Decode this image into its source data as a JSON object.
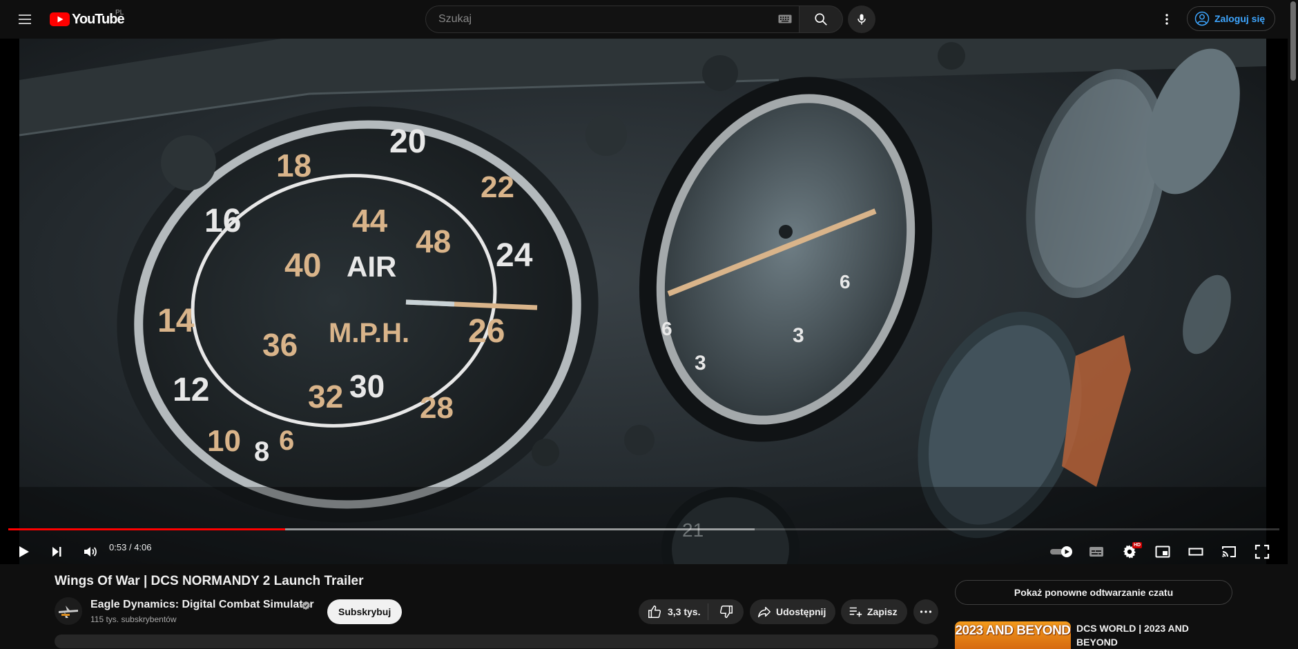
{
  "header": {
    "logo_text": "YouTube",
    "region": "PL",
    "search_placeholder": "Szukaj",
    "signin_label": "Zaloguj się"
  },
  "player": {
    "time_current": "0:53",
    "time_separator": "/",
    "time_total": "4:06",
    "progress_played": 0.218,
    "progress_buffered": 0.587,
    "hd_badge": "HD",
    "gauge_airspeed": {
      "outer_numbers": [
        "6",
        "8",
        "10",
        "12",
        "14",
        "16",
        "18",
        "20",
        "22",
        "24",
        "26",
        "28"
      ],
      "inner_numbers": [
        "30",
        "32",
        "36",
        "40",
        "44",
        "48"
      ],
      "word_top": "AIR",
      "word_bottom": "M.P.H."
    },
    "gauge_right_numbers": [
      "3",
      "6",
      "3",
      "6",
      "21"
    ]
  },
  "video": {
    "title": "Wings Of War | DCS NORMANDY 2 Launch Trailer",
    "channel_name": "Eagle Dynamics: Digital Combat Simulator",
    "subscribers": "115 tys. subskrybentów",
    "subscribe_label": "Subskrybuj",
    "likes": "3,3 tys.",
    "share_label": "Udostępnij",
    "save_label": "Zapisz"
  },
  "sidebar": {
    "chat_replay_label": "Pokaż ponowne odtwarzanie czatu",
    "recommended": [
      {
        "thumb_text": "2023 AND BEYOND",
        "title": "DCS WORLD | 2023 AND BEYOND"
      }
    ]
  },
  "colors": {
    "background": "#0f0f0f",
    "accent_red": "#ff0000",
    "link_blue": "#3ea6ff",
    "pill_bg": "#272727"
  }
}
